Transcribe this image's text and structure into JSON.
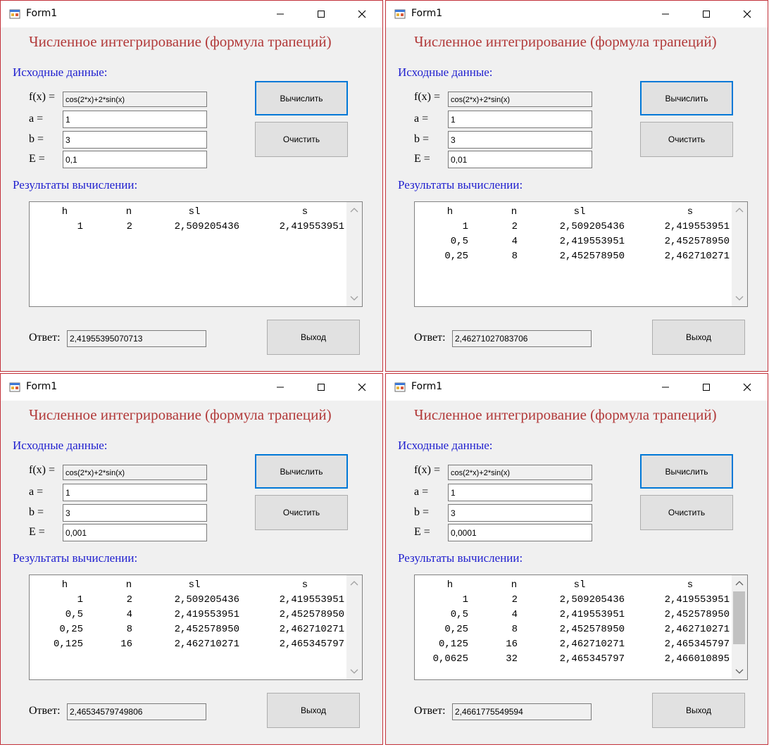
{
  "windows": [
    {
      "title": "Form1",
      "heading": "Численное интегрирование (формула трапеций)",
      "input_section_label": "Исходные данные:",
      "fx_label": "f(x) =",
      "fx_value": "cos(2*x)+2*sin(x)",
      "a_label": "a =",
      "a_value": "1",
      "b_label": "b =",
      "b_value": "3",
      "e_label": "E =",
      "e_value": "0,1",
      "calc_button": "Вычислить",
      "clear_button": "Очистить",
      "results_section_label": "Результаты вычислении:",
      "columns": [
        "h",
        "n",
        "sl",
        "s"
      ],
      "rows": [
        [
          "1",
          "2",
          "2,509205436",
          "2,419553951"
        ]
      ],
      "answer_label": "Ответ:",
      "answer_value": "2,41955395070713",
      "exit_button": "Выход"
    },
    {
      "title": "Form1",
      "heading": "Численное интегрирование (формула трапеций)",
      "input_section_label": "Исходные данные:",
      "fx_label": "f(x) =",
      "fx_value": "cos(2*x)+2*sin(x)",
      "a_label": "a =",
      "a_value": "1",
      "b_label": "b =",
      "b_value": "3",
      "e_label": "E =",
      "e_value": "0,01",
      "calc_button": "Вычислить",
      "clear_button": "Очистить",
      "results_section_label": "Результаты вычислении:",
      "columns": [
        "h",
        "n",
        "sl",
        "s"
      ],
      "rows": [
        [
          "1",
          "2",
          "2,509205436",
          "2,419553951"
        ],
        [
          "0,5",
          "4",
          "2,419553951",
          "2,452578950"
        ],
        [
          "0,25",
          "8",
          "2,452578950",
          "2,462710271"
        ]
      ],
      "answer_label": "Ответ:",
      "answer_value": "2,46271027083706",
      "exit_button": "Выход"
    },
    {
      "title": "Form1",
      "heading": "Численное интегрирование (формула трапеций)",
      "input_section_label": "Исходные данные:",
      "fx_label": "f(x) =",
      "fx_value": "cos(2*x)+2*sin(x)",
      "a_label": "a =",
      "a_value": "1",
      "b_label": "b =",
      "b_value": "3",
      "e_label": "E =",
      "e_value": "0,001",
      "calc_button": "Вычислить",
      "clear_button": "Очистить",
      "results_section_label": "Результаты вычислении:",
      "columns": [
        "h",
        "n",
        "sl",
        "s"
      ],
      "rows": [
        [
          "1",
          "2",
          "2,509205436",
          "2,419553951"
        ],
        [
          "0,5",
          "4",
          "2,419553951",
          "2,452578950"
        ],
        [
          "0,25",
          "8",
          "2,452578950",
          "2,462710271"
        ],
        [
          "0,125",
          "16",
          "2,462710271",
          "2,465345797"
        ]
      ],
      "answer_label": "Ответ:",
      "answer_value": "2,46534579749806",
      "exit_button": "Выход"
    },
    {
      "title": "Form1",
      "heading": "Численное интегрирование (формула трапеций)",
      "input_section_label": "Исходные данные:",
      "fx_label": "f(x) =",
      "fx_value": "cos(2*x)+2*sin(x)",
      "a_label": "a =",
      "a_value": "1",
      "b_label": "b =",
      "b_value": "3",
      "e_label": "E =",
      "e_value": "0,0001",
      "calc_button": "Вычислить",
      "clear_button": "Очистить",
      "results_section_label": "Результаты вычислении:",
      "columns": [
        "h",
        "n",
        "sl",
        "s"
      ],
      "rows": [
        [
          "1",
          "2",
          "2,509205436",
          "2,419553951"
        ],
        [
          "0,5",
          "4",
          "2,419553951",
          "2,452578950"
        ],
        [
          "0,25",
          "8",
          "2,452578950",
          "2,462710271"
        ],
        [
          "0,125",
          "16",
          "2,462710271",
          "2,465345797"
        ],
        [
          "0,0625",
          "32",
          "2,465345797",
          "2,466010895"
        ]
      ],
      "answer_label": "Ответ:",
      "answer_value": "2,4661775549594",
      "exit_button": "Выход"
    }
  ]
}
